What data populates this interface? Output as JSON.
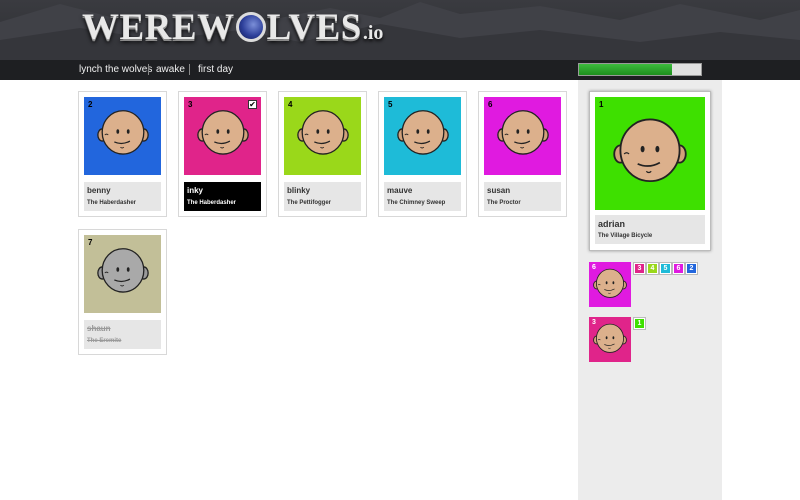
{
  "app": {
    "logo_text": "WEREW",
    "logo_text_end": "LVES",
    "logo_tld": ".io"
  },
  "nav": {
    "items": [
      {
        "label": "lynch the wolves"
      },
      {
        "label": "awake"
      },
      {
        "label": "first day"
      }
    ]
  },
  "progress": {
    "value": 0.76,
    "color": "#2aa52a"
  },
  "players": [
    {
      "number": "2",
      "name": "benny",
      "role": "The Haberdasher",
      "color": "#2266dd",
      "selected": false,
      "dead": false
    },
    {
      "number": "3",
      "name": "inky",
      "role": "The Haberdasher",
      "color": "#e0248a",
      "selected": true,
      "dead": false
    },
    {
      "number": "4",
      "name": "blinky",
      "role": "The Pettifogger",
      "color": "#9ad81a",
      "selected": false,
      "dead": false
    },
    {
      "number": "5",
      "name": "mauve",
      "role": "The Chimney Sweep",
      "color": "#1ebbd8",
      "selected": false,
      "dead": false
    },
    {
      "number": "6",
      "name": "susan",
      "role": "The Proctor",
      "color": "#e01ae0",
      "selected": false,
      "dead": false
    },
    {
      "number": "7",
      "name": "shaun",
      "role": "The Eremite",
      "color": "#c2bf98",
      "selected": false,
      "dead": true
    }
  ],
  "me": {
    "number": "1",
    "name": "adrian",
    "role": "The Village Bicycle",
    "color": "#3ee000"
  },
  "votes": [
    {
      "target": {
        "number": "6",
        "color": "#e01ae0"
      },
      "voters": [
        {
          "number": "3",
          "color": "#e0248a"
        },
        {
          "number": "4",
          "color": "#9ad81a"
        },
        {
          "number": "5",
          "color": "#1ebbd8"
        },
        {
          "number": "6",
          "color": "#e01ae0"
        },
        {
          "number": "2",
          "color": "#2266dd"
        }
      ]
    },
    {
      "target": {
        "number": "3",
        "color": "#e0248a"
      },
      "voters": [
        {
          "number": "1",
          "color": "#3ee000"
        }
      ]
    }
  ],
  "icons": {
    "check": "check-icon",
    "moon": "moon-icon",
    "face": "face-icon"
  }
}
